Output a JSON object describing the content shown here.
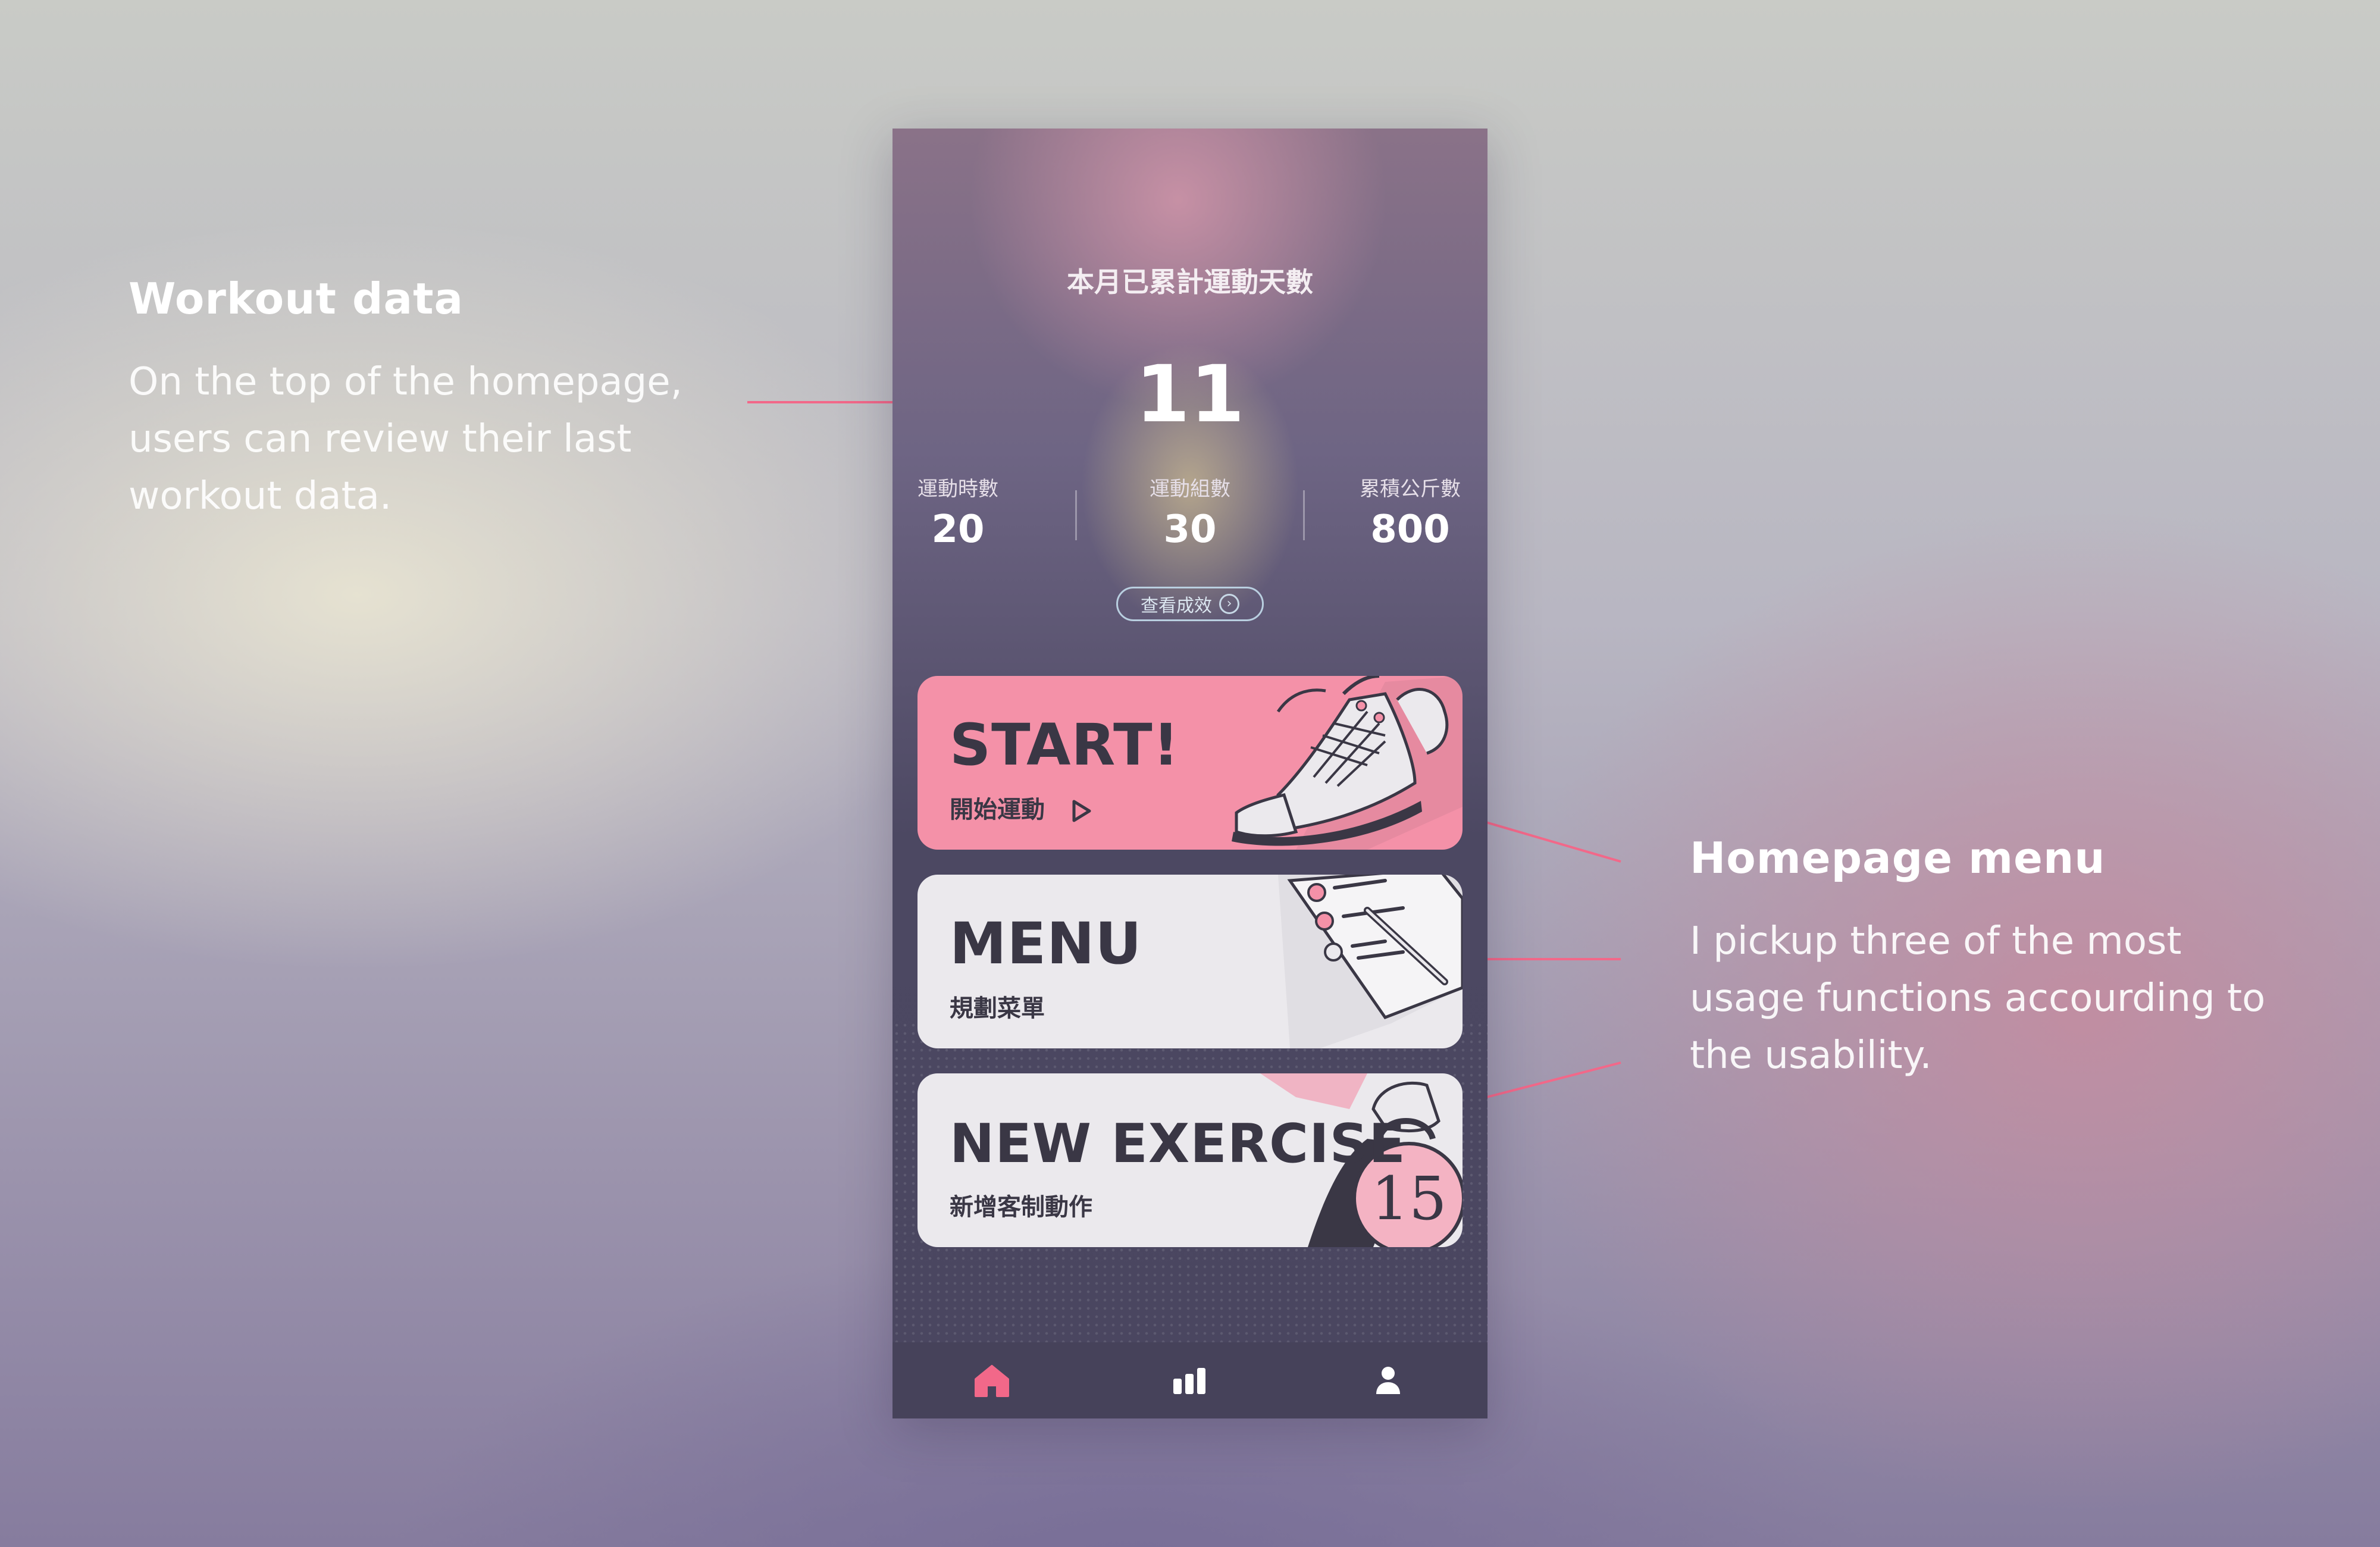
{
  "annotations": {
    "workout": {
      "title": "Workout data",
      "body": "On the top of the homepage, users can review their last workout data."
    },
    "menu": {
      "title": "Homepage menu",
      "body": "I pickup three of the most usage functions accourding to the usability."
    }
  },
  "header": {
    "label": "本月已累計運動天數",
    "value": "11"
  },
  "stats": [
    {
      "label": "運動時數",
      "value": "20"
    },
    {
      "label": "運動組數",
      "value": "30"
    },
    {
      "label": "累積公斤數",
      "value": "800"
    }
  ],
  "results_button": {
    "label": "查看成效",
    "icon": "chevron-right-circle-icon"
  },
  "cards": {
    "start": {
      "title": "START!",
      "subtitle": "開始運動",
      "icon": "play-outline-icon"
    },
    "menu": {
      "title": "MENU",
      "subtitle": "規劃菜單"
    },
    "new_exercise": {
      "title": "NEW EXERCISE",
      "subtitle": "新增客制動作",
      "kettlebell_number": "15"
    }
  },
  "tabbar": {
    "items": [
      {
        "icon": "home-icon",
        "active": true
      },
      {
        "icon": "bar-chart-icon",
        "active": false
      },
      {
        "icon": "user-icon",
        "active": false
      }
    ]
  },
  "colors": {
    "accent": "#f26889",
    "start_card": "#f491a8",
    "card_light": "#ebe9ed",
    "tabbar": "#46425a",
    "card_text": "#3a3745"
  }
}
